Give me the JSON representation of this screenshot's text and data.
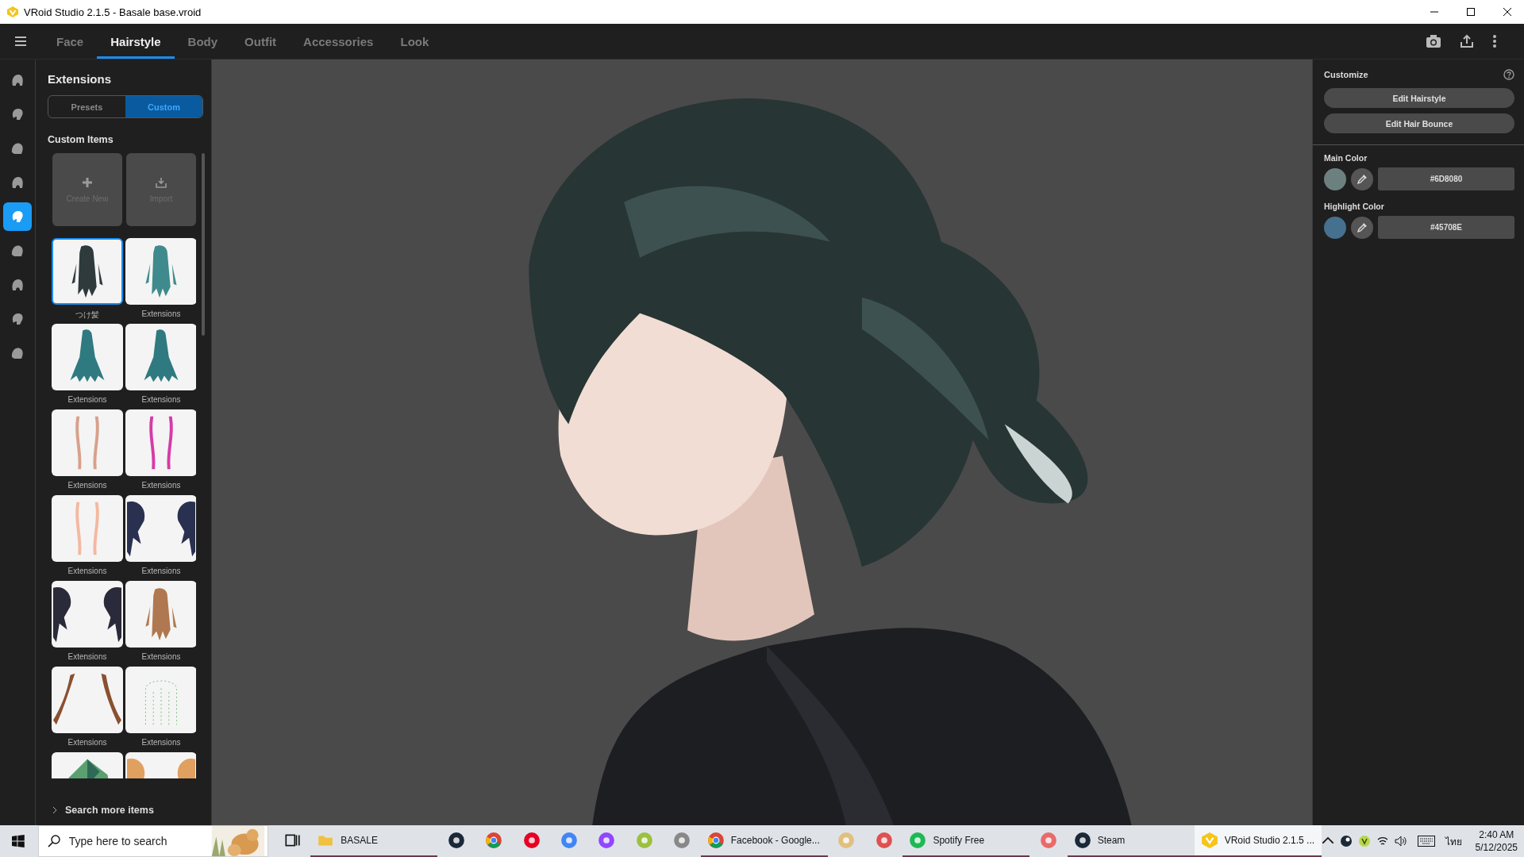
{
  "window": {
    "title": "VRoid Studio 2.1.5 - Basale base.vroid"
  },
  "tabs": [
    {
      "label": "Face",
      "selected": false
    },
    {
      "label": "Hairstyle",
      "selected": true
    },
    {
      "label": "Body",
      "selected": false
    },
    {
      "label": "Outfit",
      "selected": false
    },
    {
      "label": "Accessories",
      "selected": false
    },
    {
      "label": "Look",
      "selected": false
    }
  ],
  "rail": [
    {
      "selected": false
    },
    {
      "selected": false
    },
    {
      "selected": false
    },
    {
      "selected": false
    },
    {
      "selected": true
    },
    {
      "selected": false
    },
    {
      "selected": false
    },
    {
      "selected": false
    },
    {
      "selected": false
    }
  ],
  "panel": {
    "title": "Extensions",
    "segments": [
      {
        "label": "Presets",
        "selected": false
      },
      {
        "label": "Custom",
        "selected": true
      }
    ],
    "section": "Custom Items",
    "actions": [
      {
        "kind": "create",
        "label": "Create New"
      },
      {
        "kind": "import",
        "label": "Import"
      }
    ],
    "items": [
      {
        "label": "つけ髪",
        "selected": true
      },
      {
        "label": "Extensions",
        "selected": false
      },
      {
        "label": "Extensions",
        "selected": false
      },
      {
        "label": "Extensions",
        "selected": false
      },
      {
        "label": "Extensions",
        "selected": false
      },
      {
        "label": "Extensions",
        "selected": false
      },
      {
        "label": "Extensions",
        "selected": false
      },
      {
        "label": "Extensions",
        "selected": false
      },
      {
        "label": "Extensions",
        "selected": false
      },
      {
        "label": "Extensions",
        "selected": false
      },
      {
        "label": "Extensions",
        "selected": false
      },
      {
        "label": "Extensions",
        "selected": false
      },
      {
        "selected": false
      },
      {
        "selected": false
      }
    ],
    "search_more": "Search more items"
  },
  "customize": {
    "title": "Customize",
    "buttons": [
      "Edit Hairstyle",
      "Edit Hair Bounce"
    ],
    "colors": [
      {
        "label": "Main Color",
        "color": "#6d8080",
        "value": "#6D8080"
      },
      {
        "label": "Highlight Color",
        "color": "#45708e",
        "value": "#45708E"
      }
    ]
  },
  "taskbar": {
    "search": {
      "placeholder": "Type here to search"
    },
    "items": [
      {
        "kind": "taskview",
        "running": false,
        "selected": false
      },
      {
        "kind": "folder",
        "label": "BASALE",
        "running": true,
        "selected": false
      },
      {
        "kind": "steam",
        "running": false,
        "selected": false
      },
      {
        "kind": "chrome",
        "running": false,
        "selected": false
      },
      {
        "kind": "pinterest",
        "running": false,
        "selected": false
      },
      {
        "kind": "translate",
        "running": false,
        "selected": false
      },
      {
        "kind": "twitch",
        "running": false,
        "selected": false
      },
      {
        "kind": "lime",
        "running": false,
        "selected": false
      },
      {
        "kind": "swirl",
        "running": false,
        "selected": false
      },
      {
        "kind": "chrome",
        "label": "Facebook - Google...",
        "running": true,
        "selected": false
      },
      {
        "kind": "palette",
        "running": false,
        "selected": false
      },
      {
        "kind": "scissors",
        "running": false,
        "selected": false
      },
      {
        "kind": "spotify",
        "label": "Spotify Free",
        "running": true,
        "selected": false
      },
      {
        "kind": "colorball",
        "running": false,
        "selected": false
      },
      {
        "kind": "steam",
        "label": "Steam",
        "running": true,
        "selected": false
      },
      {
        "kind": "vroid",
        "label": "VRoid Studio 2.1.5 ...",
        "running": true,
        "selected": true
      }
    ],
    "tray": {
      "language": "ไทย",
      "time": "2:40 AM",
      "date": "5/12/2025"
    }
  }
}
